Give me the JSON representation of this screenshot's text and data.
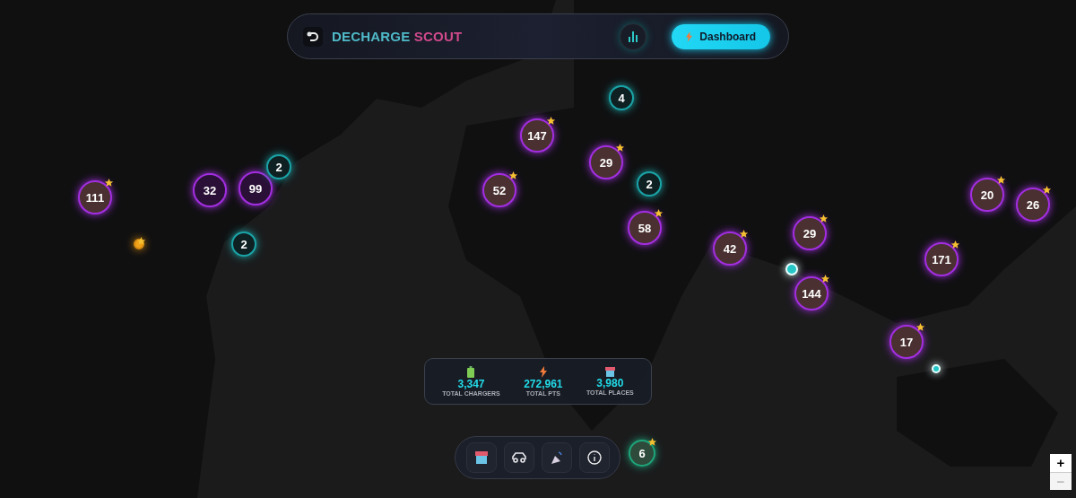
{
  "header": {
    "brand_first": "DECHARGE",
    "brand_second": "SCOUT",
    "dashboard_button": "Dashboard"
  },
  "markers": [
    {
      "kind": "purple",
      "label": "111",
      "starred": true
    },
    {
      "kind": "purple",
      "label": "32",
      "starred": false
    },
    {
      "kind": "purple",
      "label": "99",
      "starred": false
    },
    {
      "kind": "teal",
      "label": "2",
      "starred": false
    },
    {
      "kind": "teal",
      "label": "2",
      "starred": false
    },
    {
      "kind": "teal",
      "label": "4",
      "starred": false
    },
    {
      "kind": "purple",
      "label": "147",
      "starred": true
    },
    {
      "kind": "purple",
      "label": "29",
      "starred": true
    },
    {
      "kind": "purple",
      "label": "52",
      "starred": true
    },
    {
      "kind": "teal",
      "label": "2",
      "starred": false
    },
    {
      "kind": "purple",
      "label": "58",
      "starred": true
    },
    {
      "kind": "purple",
      "label": "42",
      "starred": true
    },
    {
      "kind": "purple",
      "label": "29",
      "starred": true
    },
    {
      "kind": "purple",
      "label": "144",
      "starred": true
    },
    {
      "kind": "purple",
      "label": "171",
      "starred": true
    },
    {
      "kind": "purple",
      "label": "20",
      "starred": true
    },
    {
      "kind": "purple",
      "label": "26",
      "starred": true
    },
    {
      "kind": "purple",
      "label": "17",
      "starred": true
    },
    {
      "kind": "green",
      "label": "6",
      "starred": true
    }
  ],
  "points": [
    {
      "kind": "orange",
      "starred": true
    },
    {
      "kind": "teal",
      "starred": false
    },
    {
      "kind": "teal",
      "starred": false
    }
  ],
  "stats": [
    {
      "kind": "battery",
      "value": "3,347",
      "label": "TOTAL CHARGERS"
    },
    {
      "kind": "bolt",
      "value": "272,961",
      "label": "TOTAL PTS"
    },
    {
      "kind": "store",
      "value": "3,980",
      "label": "TOTAL PLACES"
    }
  ],
  "toolbar": [
    {
      "kind": "store"
    },
    {
      "kind": "car"
    },
    {
      "kind": "satellite"
    },
    {
      "kind": "info"
    }
  ],
  "zoom": {
    "plus": "+",
    "minus": "−"
  }
}
